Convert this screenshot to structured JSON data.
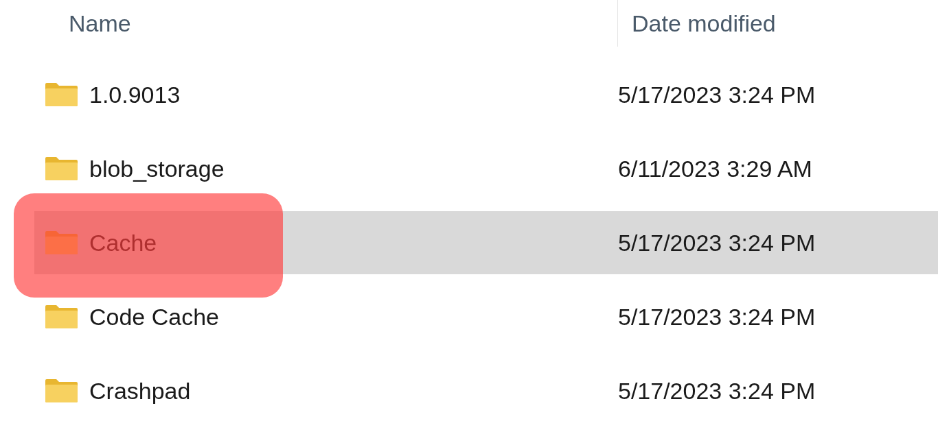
{
  "columns": [
    "Name",
    "Date modified"
  ],
  "rows": [
    {
      "name": "1.0.9013",
      "date": "5/17/2023 3:24 PM",
      "selected": false,
      "highlighted": false
    },
    {
      "name": "blob_storage",
      "date": "6/11/2023 3:29 AM",
      "selected": false,
      "highlighted": false
    },
    {
      "name": "Cache",
      "date": "5/17/2023 3:24 PM",
      "selected": true,
      "highlighted": true
    },
    {
      "name": "Code Cache",
      "date": "5/17/2023 3:24 PM",
      "selected": false,
      "highlighted": false
    },
    {
      "name": "Crashpad",
      "date": "5/17/2023 3:24 PM",
      "selected": false,
      "highlighted": false
    }
  ]
}
